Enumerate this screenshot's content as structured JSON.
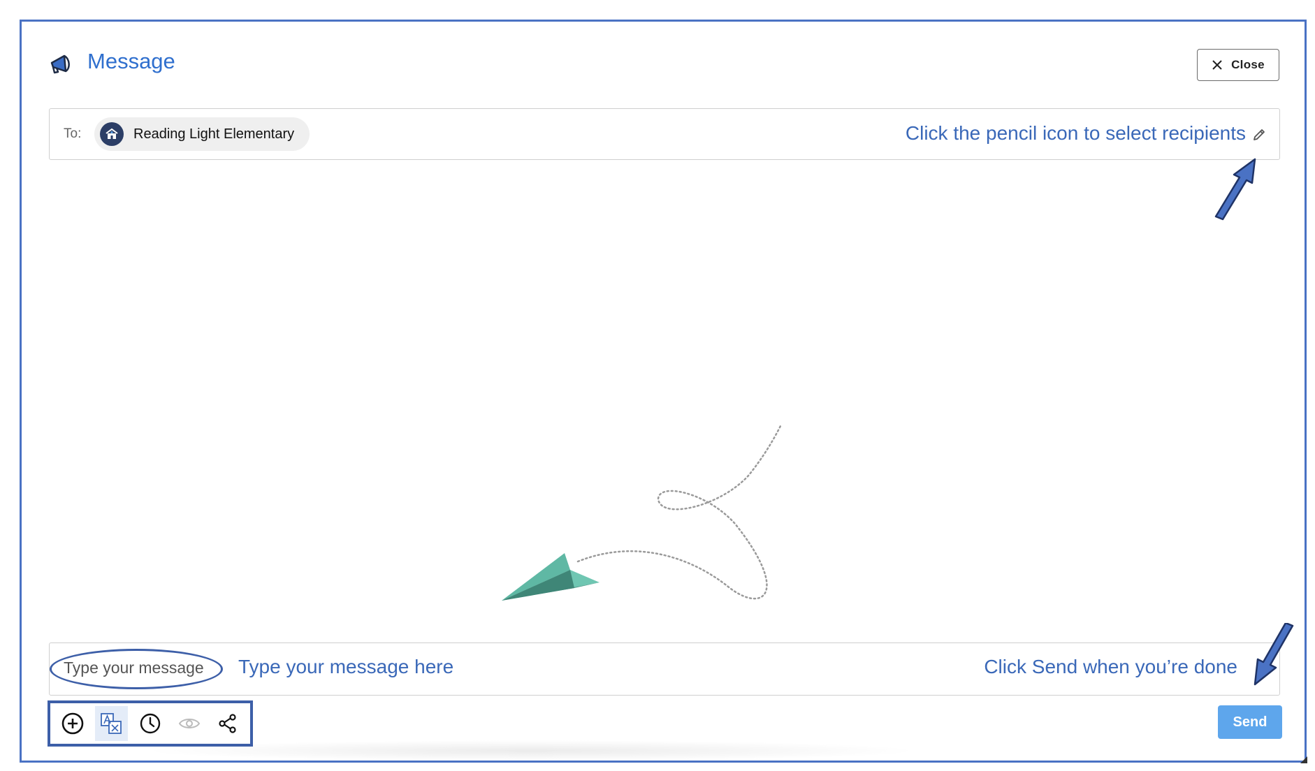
{
  "header": {
    "title": "Message",
    "icon": "megaphone-icon"
  },
  "close_button": {
    "label": "Close"
  },
  "recipients": {
    "to_label": "To:",
    "chips": [
      {
        "name": "Reading Light Elementary",
        "icon": "school-icon"
      }
    ],
    "hint": "Click the pencil icon to select recipients"
  },
  "compose": {
    "placeholder": "Type your message",
    "hint_type": "Type your message here",
    "hint_send": "Click Send when you’re done"
  },
  "toolbar": {
    "tools": [
      {
        "icon": "add-circle-icon",
        "active": false
      },
      {
        "icon": "translate-icon",
        "active": true
      },
      {
        "icon": "clock-icon",
        "active": false
      },
      {
        "icon": "eye-icon",
        "active": false
      },
      {
        "icon": "share-icon",
        "active": false
      }
    ]
  },
  "send_button": {
    "label": "Send"
  },
  "colors": {
    "accent": "#2f6fce",
    "annotation": "#3a68b8",
    "send": "#5ea6ec",
    "plane": "#5fb8a4",
    "frame": "#4a72c4"
  }
}
